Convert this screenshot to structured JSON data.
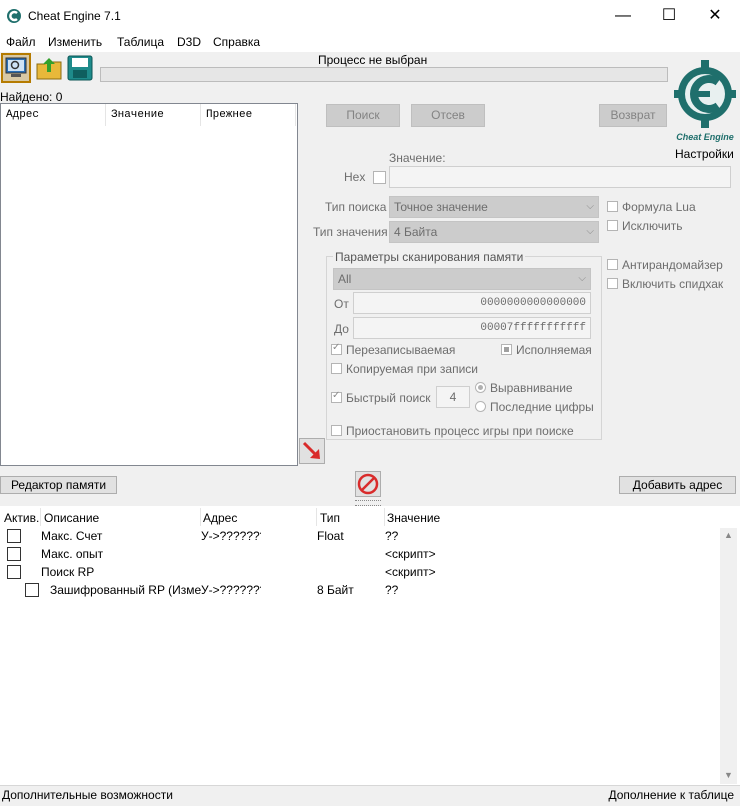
{
  "window": {
    "title": "Cheat Engine 7.1"
  },
  "menu": [
    "Файл",
    "Изменить",
    "Таблица",
    "D3D",
    "Справка"
  ],
  "process": {
    "label": "Процесс не выбран"
  },
  "found": {
    "label": "Найдено: 0"
  },
  "results_table": {
    "columns": [
      "Адрес",
      "Значение",
      "Прежнее"
    ]
  },
  "scan_buttons": {
    "search": "Поиск",
    "filter": "Отсев",
    "undo": "Возврат"
  },
  "logo": {
    "text": "Cheat Engine",
    "settings_label": "Настройки"
  },
  "value": {
    "label": "Значение:",
    "hex_label": "Hex",
    "input": ""
  },
  "scan_type": {
    "label": "Тип поиска",
    "selected": "Точное значение"
  },
  "value_type": {
    "label": "Тип значения",
    "selected": "4 Байта"
  },
  "right_options": {
    "lua_formula": "Формула Lua",
    "exclude": "Исключить",
    "antirandomizer": "Антирандомайзер",
    "speedhack": "Включить спидхак"
  },
  "memory_scan": {
    "title": "Параметры сканирования памяти",
    "region": "All",
    "from_label": "От",
    "from_value": "0000000000000000",
    "to_label": "До",
    "to_value": "00007fffffffffff",
    "writable": "Перезаписываемая",
    "executable": "Исполняемая",
    "copy_on_write": "Копируемая при записи",
    "fast_scan": "Быстрый поиск",
    "fast_scan_value": "4",
    "alignment": "Выравнивание",
    "last_digits": "Последние цифры",
    "pause_game": "Приостановить процесс игры при поиске"
  },
  "buttons": {
    "memory_editor": "Редактор памяти",
    "add_address": "Добавить адрес"
  },
  "address_table": {
    "columns": [
      "Актив.",
      "Описание",
      "Адрес",
      "Тип",
      "Значение"
    ],
    "rows": [
      {
        "description": "Макс. Счет",
        "address": "У->????????",
        "type": "Float",
        "value": "??"
      },
      {
        "description": "Макс. опыт",
        "address": "",
        "type": "",
        "value": "<скрипт>"
      },
      {
        "description": "Поиск RP",
        "address": "",
        "type": "",
        "value": "<скрипт>"
      },
      {
        "description": "Зашифрованный RP (Измен",
        "address": "У->????????",
        "type": "8 Байт",
        "value": "??"
      }
    ]
  },
  "statusbar": {
    "left": "Дополнительные возможности",
    "right": "Дополнение к таблице"
  },
  "colors": {
    "logo_teal": "#1f6f6c",
    "arrow_red": "#d92b2b",
    "selected_tool": "#b57b00"
  }
}
